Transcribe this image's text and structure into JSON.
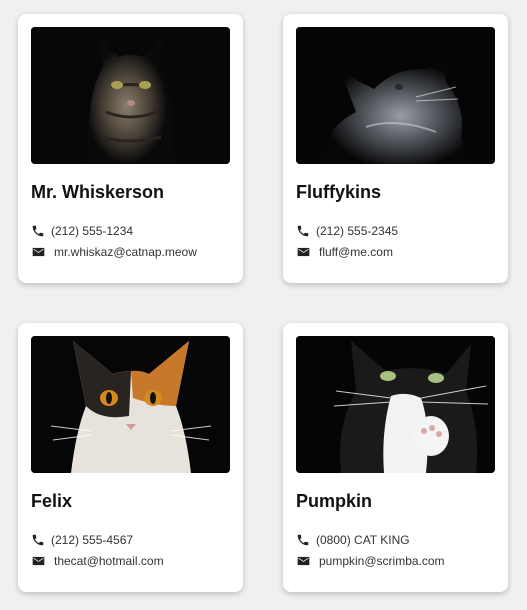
{
  "cards": [
    {
      "name": "Mr. Whiskerson",
      "phone": "(212) 555-1234",
      "email": "mr.whiskaz@catnap.meow",
      "photo": "tabby-cat-photo"
    },
    {
      "name": "Fluffykins",
      "phone": "(212) 555-2345",
      "email": "fluff@me.com",
      "photo": "gray-longhair-cat-photo"
    },
    {
      "name": "Felix",
      "phone": "(212) 555-4567",
      "email": "thecat@hotmail.com",
      "photo": "calico-cat-photo"
    },
    {
      "name": "Pumpkin",
      "phone": "(0800) CAT KING",
      "email": "pumpkin@scrimba.com",
      "photo": "tuxedo-cat-photo"
    }
  ],
  "icons": {
    "phone": "phone-icon",
    "email": "envelope-icon"
  },
  "colors": {
    "background": "#f0f0f0",
    "card": "#ffffff",
    "text": "#111111"
  }
}
